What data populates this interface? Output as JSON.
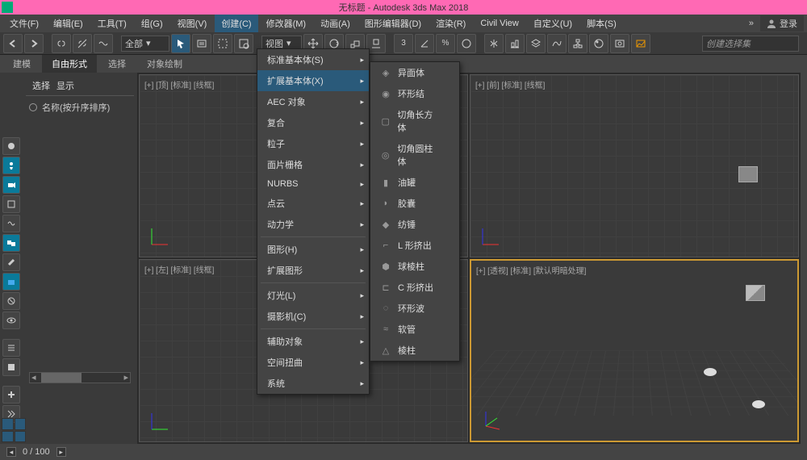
{
  "title": "无标题 - Autodesk 3ds Max 2018",
  "menubar": {
    "items": [
      "文件(F)",
      "编辑(E)",
      "工具(T)",
      "组(G)",
      "视图(V)",
      "创建(C)",
      "修改器(M)",
      "动画(A)",
      "图形编辑器(D)",
      "渲染(R)",
      "Civil View",
      "自定义(U)",
      "脚本(S)"
    ],
    "active_index": 5,
    "user_label": "登录"
  },
  "toolbar": {
    "filter_dropdown": "全部",
    "view_dropdown": "视图",
    "selection_set": "创建选择集"
  },
  "ribbon_tabs": {
    "items": [
      "建模",
      "自由形式",
      "选择",
      "对象绘制"
    ],
    "active_index": 1
  },
  "sidebar_panel": {
    "tabs": [
      "选择",
      "显示"
    ],
    "sort_label": "名称(按升序排序)"
  },
  "viewports": {
    "top": "[+] [顶] [标准] [线框]",
    "front": "[+] [前] [标准] [线框]",
    "left": "[+] [左] [标准] [线框]",
    "persp": "[+] [透视] [标准] [默认明暗处理]"
  },
  "create_menu": {
    "items": [
      {
        "label": "标准基本体(S)",
        "arrow": true
      },
      {
        "label": "扩展基本体(X)",
        "arrow": true,
        "highlight": true
      },
      {
        "label": "AEC 对象",
        "arrow": true
      },
      {
        "label": "复合",
        "arrow": true
      },
      {
        "label": "粒子",
        "arrow": true
      },
      {
        "label": "面片栅格",
        "arrow": true
      },
      {
        "label": "NURBS",
        "arrow": true
      },
      {
        "label": "点云",
        "arrow": true
      },
      {
        "label": "动力学",
        "arrow": true
      },
      {
        "sep": true
      },
      {
        "label": "图形(H)",
        "arrow": true
      },
      {
        "label": "扩展图形",
        "arrow": true
      },
      {
        "sep": true
      },
      {
        "label": "灯光(L)",
        "arrow": true
      },
      {
        "label": "摄影机(C)",
        "arrow": true
      },
      {
        "sep": true
      },
      {
        "label": "辅助对象",
        "arrow": true
      },
      {
        "label": "空间扭曲",
        "arrow": true
      },
      {
        "label": "系统",
        "arrow": true
      }
    ]
  },
  "ext_prim_menu": {
    "items": [
      "异面体",
      "环形结",
      "切角长方体",
      "切角圆柱体",
      "油罐",
      "胶囊",
      "纺锤",
      "L 形挤出",
      "球棱柱",
      "C 形挤出",
      "环形波",
      "软管",
      "棱柱"
    ]
  },
  "status": {
    "frame": "0 / 100"
  }
}
